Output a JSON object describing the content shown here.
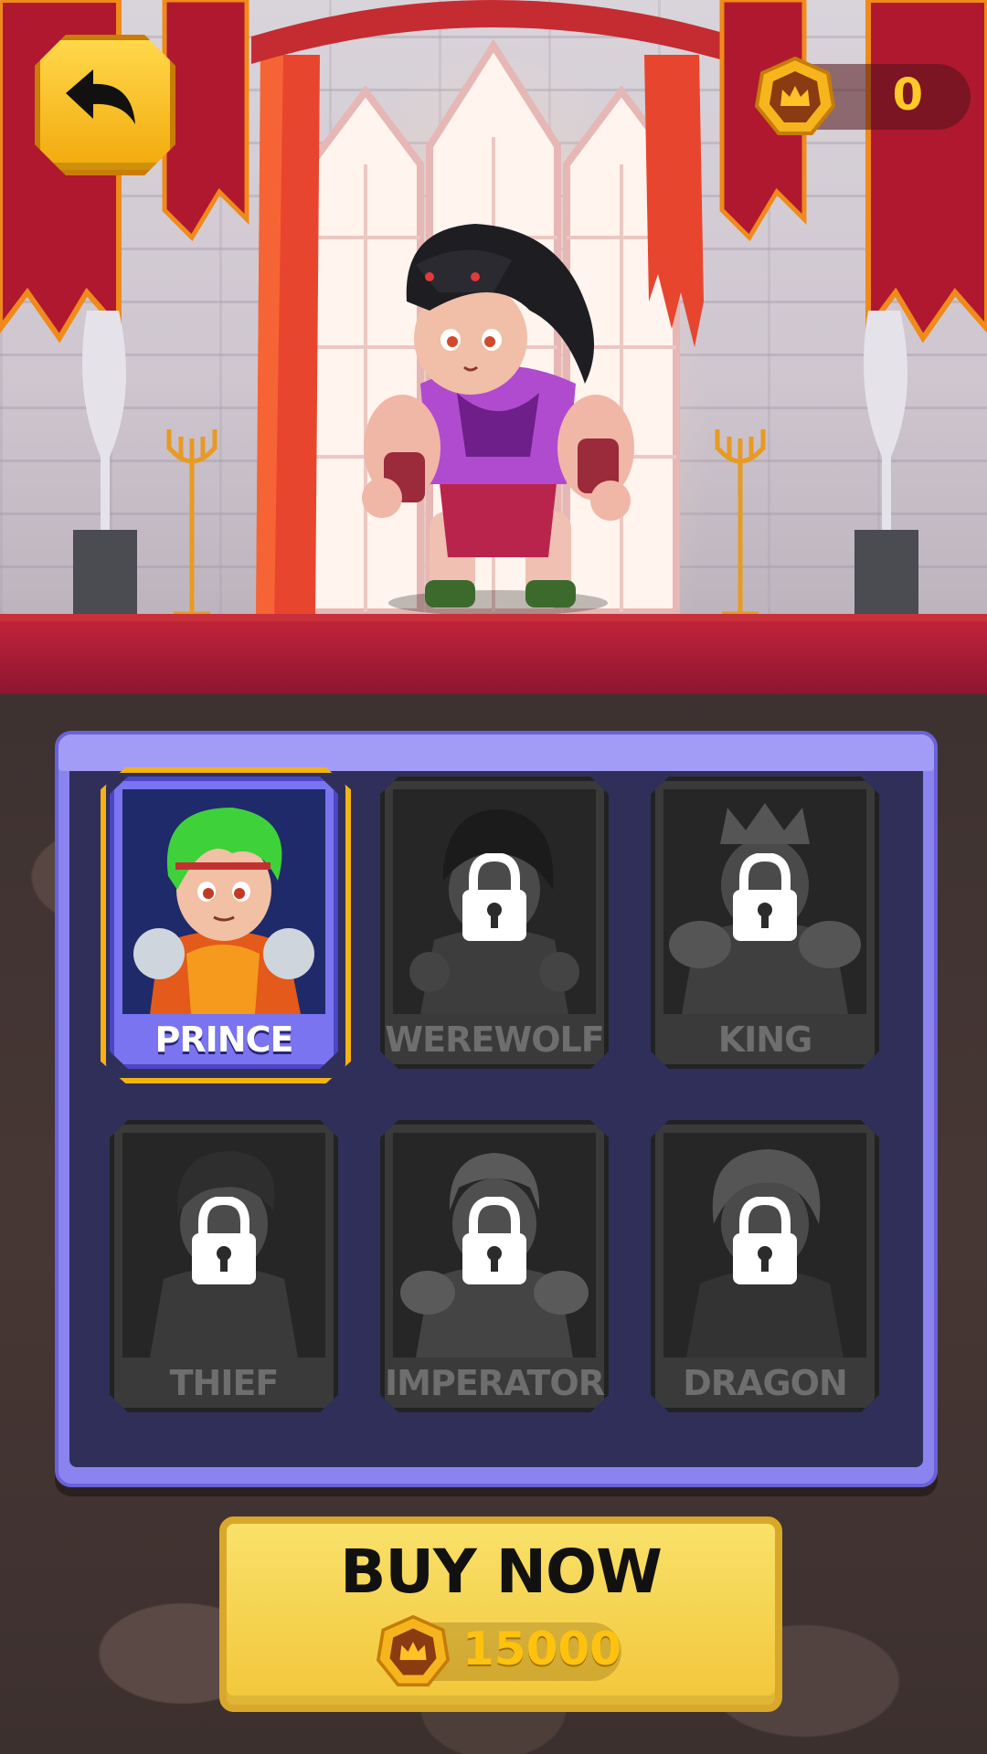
{
  "header": {
    "back_icon": "back-arrow-icon",
    "coins": "0",
    "coin_icon": "crown-coin-icon"
  },
  "characters": [
    {
      "name": "PRINCE",
      "locked": false,
      "selected": true
    },
    {
      "name": "WEREWOLF",
      "locked": true,
      "selected": false
    },
    {
      "name": "KING",
      "locked": true,
      "selected": false
    },
    {
      "name": "THIEF",
      "locked": true,
      "selected": false
    },
    {
      "name": "IMPERATOR",
      "locked": true,
      "selected": false
    },
    {
      "name": "DRAGON",
      "locked": true,
      "selected": false
    }
  ],
  "buy": {
    "label": "BUY NOW",
    "price": "15000",
    "price_icon": "crown-coin-icon"
  },
  "colors": {
    "accent_gold": "#f5b213",
    "panel_purple": "#8a83f0",
    "banner_red": "#b0182f"
  }
}
